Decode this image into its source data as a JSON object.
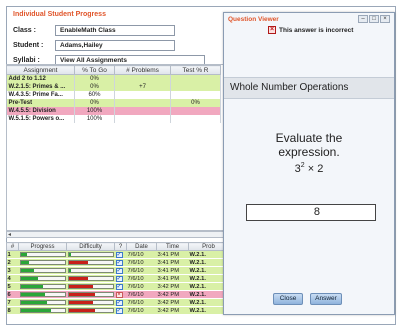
{
  "window": {
    "title": "Individual Student Progress"
  },
  "form": {
    "class_label": "Class :",
    "class_value": "EnableMath Class",
    "student_label": "Student :",
    "student_value": "Adams,Hailey",
    "syllabi_label": "Syllabi :",
    "syllabi_value": "View All Assignments"
  },
  "assignments": {
    "headers": [
      "Assignment",
      "% To Go",
      "# Problems",
      "Test % R"
    ],
    "rows": [
      {
        "name": "Add 2 to 1.12",
        "togo": "0%",
        "problems": "",
        "test": "",
        "style": "green"
      },
      {
        "name": "W.2.1.5: Primes & ...",
        "togo": "0%",
        "problems": "+7",
        "test": "",
        "style": "green"
      },
      {
        "name": "W.4.3.5: Prime Fa...",
        "togo": "60%",
        "problems": "",
        "test": "",
        "style": "white"
      },
      {
        "name": "Pre-Test",
        "togo": "0%",
        "problems": "",
        "test": "0%",
        "style": "green"
      },
      {
        "name": "W.4.5.5: Division",
        "togo": "100%",
        "problems": "",
        "test": "",
        "style": "pink"
      },
      {
        "name": "W.5.1.5: Powers o...",
        "togo": "100%",
        "problems": "",
        "test": "",
        "style": "white"
      }
    ]
  },
  "problems": {
    "headers": [
      "#",
      "Progress",
      "Difficulty",
      "?",
      "Date",
      "Time",
      "Prob"
    ],
    "rows": [
      {
        "num": "1",
        "progress": 0.15,
        "difficulty": 0.05,
        "diff_color": "green",
        "status": "check",
        "date": "7/6/10",
        "time": "3:41 PM",
        "prob": "W.2.1."
      },
      {
        "num": "2",
        "progress": 0.2,
        "difficulty": 0.45,
        "diff_color": "red",
        "status": "check",
        "date": "7/6/10",
        "time": "3:41 PM",
        "prob": "W.2.1."
      },
      {
        "num": "3",
        "progress": 0.3,
        "difficulty": 0.05,
        "diff_color": "green",
        "status": "check",
        "date": "7/6/10",
        "time": "3:41 PM",
        "prob": "W.2.1."
      },
      {
        "num": "4",
        "progress": 0.4,
        "difficulty": 0.45,
        "diff_color": "red",
        "status": "check",
        "date": "7/6/10",
        "time": "3:41 PM",
        "prob": "W.2.1."
      },
      {
        "num": "5",
        "progress": 0.5,
        "difficulty": 0.55,
        "diff_color": "red",
        "status": "check",
        "date": "7/6/10",
        "time": "3:42 PM",
        "prob": "W.2.1."
      },
      {
        "num": "6",
        "progress": 0.55,
        "difficulty": 0.6,
        "diff_color": "red",
        "status": "x",
        "date": "7/6/10",
        "time": "3:42 PM",
        "prob": "W.2.1."
      },
      {
        "num": "7",
        "progress": 0.6,
        "difficulty": 0.55,
        "diff_color": "red",
        "status": "check",
        "date": "7/6/10",
        "time": "3:42 PM",
        "prob": "W.2.1."
      },
      {
        "num": "8",
        "progress": 0.7,
        "difficulty": 0.6,
        "diff_color": "red",
        "status": "check",
        "date": "7/6/10",
        "time": "3:42 PM",
        "prob": "W.2.1."
      }
    ]
  },
  "dialog": {
    "title": "Question Viewer",
    "incorrect_text": "This answer is incorrect",
    "topic": "Whole Number Operations",
    "question_line1": "Evaluate the",
    "question_line2": "expression.",
    "expr_base": "3",
    "expr_exp": "2",
    "expr_rest": " × 2",
    "answer": "8",
    "close_label": "Close",
    "answer_label": "Answer",
    "minimize_label": "–",
    "maximize_label": "□",
    "close_ctrl_label": "×"
  }
}
